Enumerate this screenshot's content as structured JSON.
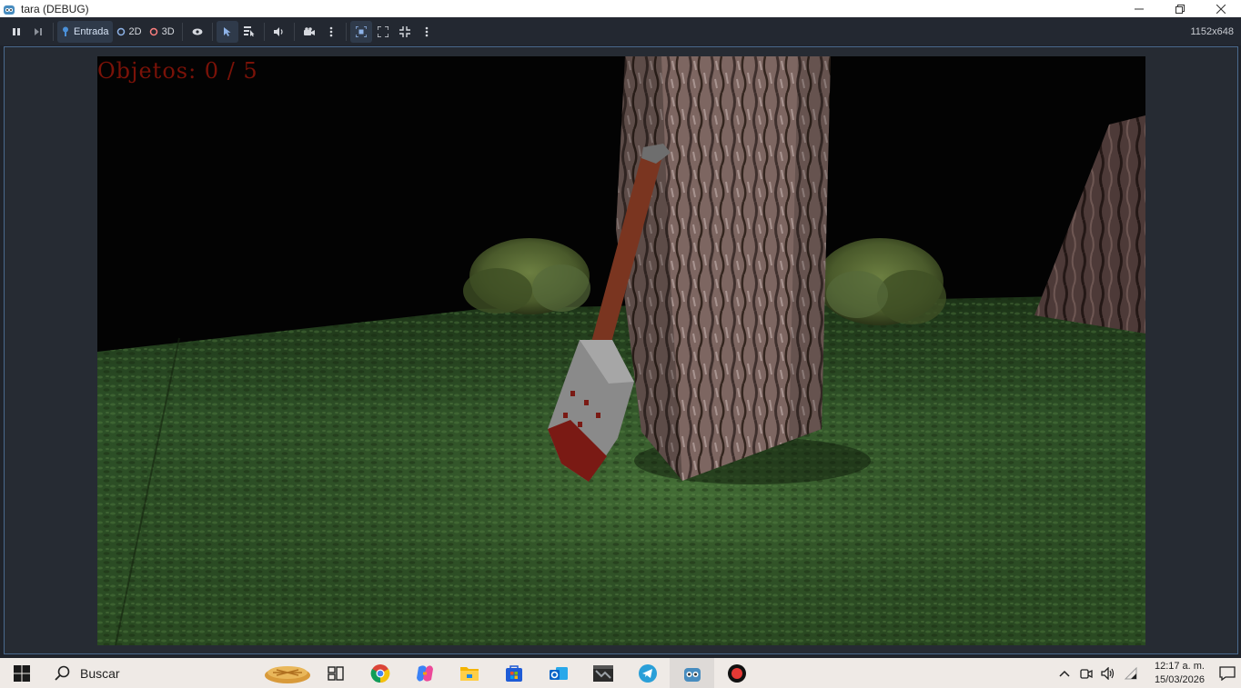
{
  "window": {
    "title": "tara (DEBUG)",
    "controls": [
      "minimize",
      "restore",
      "close"
    ]
  },
  "toolbar": {
    "input_label": "Entrada",
    "mode_2d": "2D",
    "mode_3d": "3D",
    "resolution": "1152x648"
  },
  "game": {
    "hud_text": "Objetos: 0 / 5"
  },
  "taskbar": {
    "search_label": "Buscar",
    "clock_time": "12:17 a. m.",
    "clock_date": "15/03/2026"
  },
  "colors": {
    "toolbar_bg": "#232831",
    "accent": "#4a90d9",
    "hud_text": "#7a1208",
    "taskbar_bg": "#efeae6"
  }
}
